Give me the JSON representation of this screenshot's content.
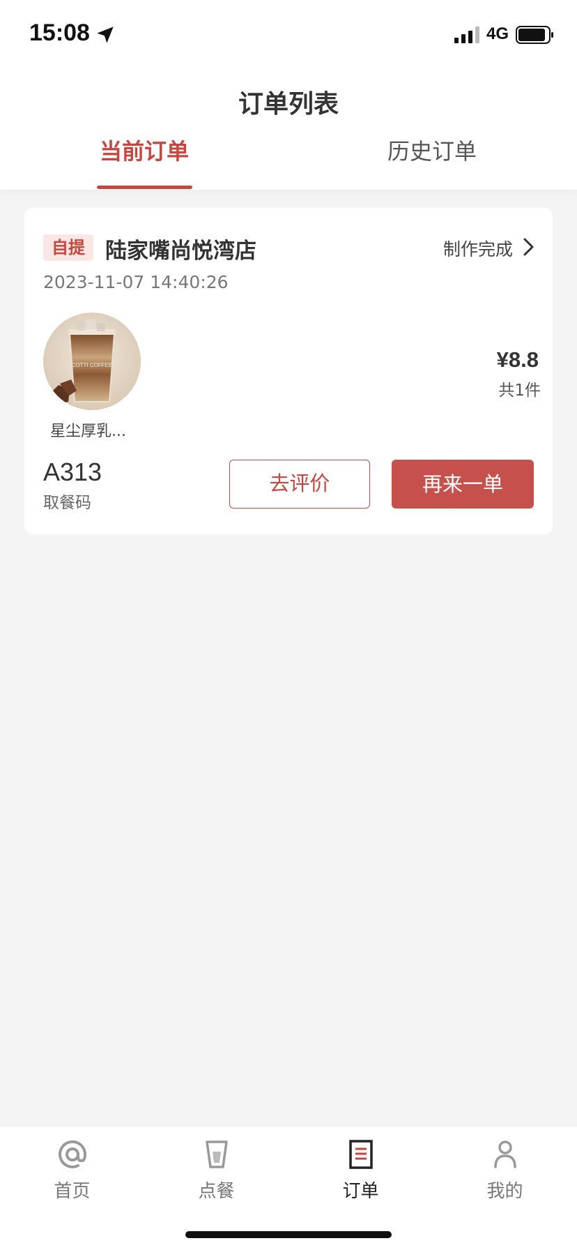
{
  "status_bar": {
    "time": "15:08",
    "network": "4G"
  },
  "header": {
    "title": "订单列表",
    "tabs": [
      {
        "label": "当前订单",
        "active": true
      },
      {
        "label": "历史订单",
        "active": false
      }
    ]
  },
  "order": {
    "pickup_type": "自提",
    "store": "陆家嘴尚悦湾店",
    "status": "制作完成",
    "time": "2023-11-07 14:40:26",
    "product_name": "星尘厚乳...",
    "price": "¥8.8",
    "item_count": "共1件",
    "pickup_code": "A313",
    "pickup_code_label": "取餐码",
    "review_label": "去评价",
    "reorder_label": "再来一单"
  },
  "bottom_nav": {
    "items": [
      {
        "label": "首页",
        "icon": "at-icon"
      },
      {
        "label": "点餐",
        "icon": "cup-icon"
      },
      {
        "label": "订单",
        "icon": "order-list-icon",
        "active": true
      },
      {
        "label": "我的",
        "icon": "user-icon"
      }
    ]
  },
  "colors": {
    "accent": "#c6473f",
    "button_fill": "#c5504c",
    "background": "#f4f4f5"
  }
}
